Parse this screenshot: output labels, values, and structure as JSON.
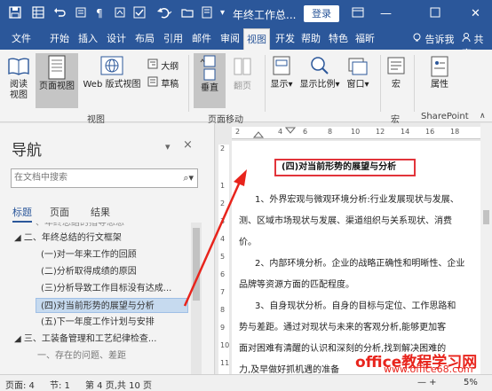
{
  "titlebar": {
    "doc_title": "年终工作总...",
    "login": "登录",
    "min": "—",
    "close": "✕"
  },
  "tabs": [
    "文件",
    "开始",
    "插入",
    "设计",
    "布局",
    "引用",
    "邮件",
    "审阅",
    "视图",
    "开发",
    "帮助",
    "特色",
    "福昕"
  ],
  "active_tab": "视图",
  "tell_me": "告诉我",
  "share": "共享",
  "ribbon": {
    "read_view": "阅读视图",
    "page_view": "页面视图",
    "web_view": "Web 版式视图",
    "outline": "大纲",
    "draft": "草稿",
    "views_group": "视图",
    "vertical": "垂直",
    "side_by_side": "翻页",
    "page_move_group": "页面移动",
    "show": "显示",
    "zoom": "显示比例",
    "window": "窗口",
    "macros": "宏",
    "macros_group": "宏",
    "properties": "属性",
    "sharepoint": "SharePoint"
  },
  "nav": {
    "title": "导航",
    "search_placeholder": "在文档中搜索",
    "tabs": [
      "标题",
      "页面",
      "结果"
    ],
    "items": [
      {
        "text": "一、年终总结的指导思想",
        "level": 1,
        "selected": false
      },
      {
        "text": "◢ 二、年终总结的行文框架",
        "level": 0,
        "selected": false
      },
      {
        "text": "(一)对一年来工作的回顾",
        "level": 2,
        "selected": false
      },
      {
        "text": "(二)分析取得成绩的原因",
        "level": 2,
        "selected": false
      },
      {
        "text": "(三)分析导致工作目标没有达成...",
        "level": 2,
        "selected": false
      },
      {
        "text": "(四)对当前形势的展望与分析",
        "level": 2,
        "selected": true
      },
      {
        "text": "(五)下一年度工作计划与安排",
        "level": 2,
        "selected": false
      },
      {
        "text": "◢ 三、工装备管理和工艺纪律检查...",
        "level": 0,
        "selected": false
      },
      {
        "text": "一、存在的问题、差距",
        "level": 1,
        "selected": false
      }
    ]
  },
  "document": {
    "heading": "(四)对当前形势的展望与分析",
    "lines": [
      "1、外界宏观与微观环境分析:行业发展现状与发展、",
      "测、区域市场现状与发展、渠道组织与关系现状、消费",
      "价。",
      "2、内部环境分析。企业的战略正确性和明晰性、企业",
      "品牌等资源方面的匹配程度。",
      "3、自身现状分析。自身的目标与定位、工作思路和",
      "势与差距。通过对现状与未来的客观分析,能够更加客",
      "面对困难有清醒的认识和深刻的分析,找到解决困难的",
      "力,及早做好抓机遇的准备"
    ],
    "ruler_top": [
      "2",
      "2",
      "4",
      "6",
      "8",
      "10",
      "12",
      "14",
      "16",
      "18"
    ],
    "ruler_left": [
      "2",
      "1",
      "2",
      "3",
      "4",
      "5",
      "6",
      "7",
      "8",
      "9",
      "10",
      "11"
    ]
  },
  "watermark": {
    "line1": "office教程学习网",
    "line2": "www.office68.com"
  },
  "status": {
    "page": "页面: 4",
    "section": "节: 1",
    "pages": "第 4 页,共 10 页",
    "zoom": "—  +  ",
    "zoom_pct": "5%"
  },
  "colors": {
    "accent": "#2b579a",
    "highlight": "#e2343a"
  }
}
